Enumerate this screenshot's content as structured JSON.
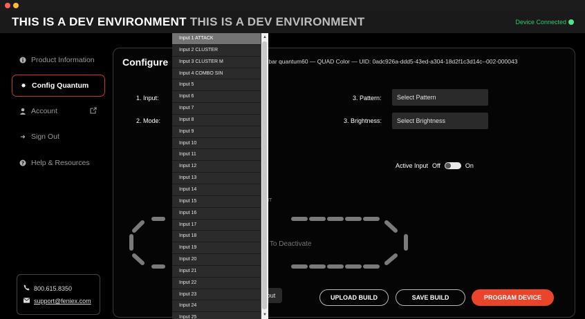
{
  "header": {
    "title_part1": "THIS IS A DEV ENVIRONMENT",
    "title_part2": "THIS IS A DEV ENVIRONMENT",
    "device_status": "Device Connected"
  },
  "sidebar": {
    "items": [
      {
        "label": "Product Information",
        "icon": "info-icon"
      },
      {
        "label": "Config Quantum",
        "icon": "gear-icon"
      },
      {
        "label": "Account",
        "icon": "user-icon"
      },
      {
        "label": "Sign Out",
        "icon": "sign-out-icon"
      },
      {
        "label": "Help & Resources",
        "icon": "help-icon"
      }
    ],
    "contact": {
      "phone": "800.615.8350",
      "email": "support@feniex.com"
    }
  },
  "main": {
    "title": "Configure",
    "uid_line": "tbar  quantum60  — QUAD Color  — UID: 0adc926a-ddd5-43ed-a304-18d2f1c3d14c--002-000043",
    "labels": {
      "input": "1. Input:",
      "mode": "2. Mode:",
      "pattern": "3. Pattern:",
      "brightness": "3. Brightness:"
    },
    "pattern_select": "Select Pattern",
    "brightness_select": "Select Brightness",
    "active_input": {
      "label": "Active Input",
      "off": "Off",
      "on": "On"
    },
    "nt_text": "NT",
    "deactivate_text": ") To Deactivate",
    "partial_button": "out",
    "buttons": {
      "upload": "UPLOAD BUILD",
      "save": "SAVE BUILD",
      "program": "PROGRAM DEVICE"
    }
  },
  "dropdown": {
    "selected": "Input 1 ATTACK",
    "options": [
      "Input 1 ATTACK",
      "Input 2 CLUSTER",
      "Input 3 CLUSTER M",
      "Input 4 COMBO SIN",
      "Input 5",
      "Input 6",
      "Input 7",
      "Input 8",
      "Input 9",
      "Input 10",
      "Input 11",
      "Input 12",
      "Input 13",
      "Input 14",
      "Input 15",
      "Input 16",
      "Input 17",
      "Input 18",
      "Input 19",
      "Input 20",
      "Input 21",
      "Input 22",
      "Input 23",
      "Input 24",
      "Input 25"
    ]
  },
  "colors": {
    "accent_red": "#e8452b",
    "connected_green": "#58e08f",
    "active_border": "#c0392b"
  }
}
